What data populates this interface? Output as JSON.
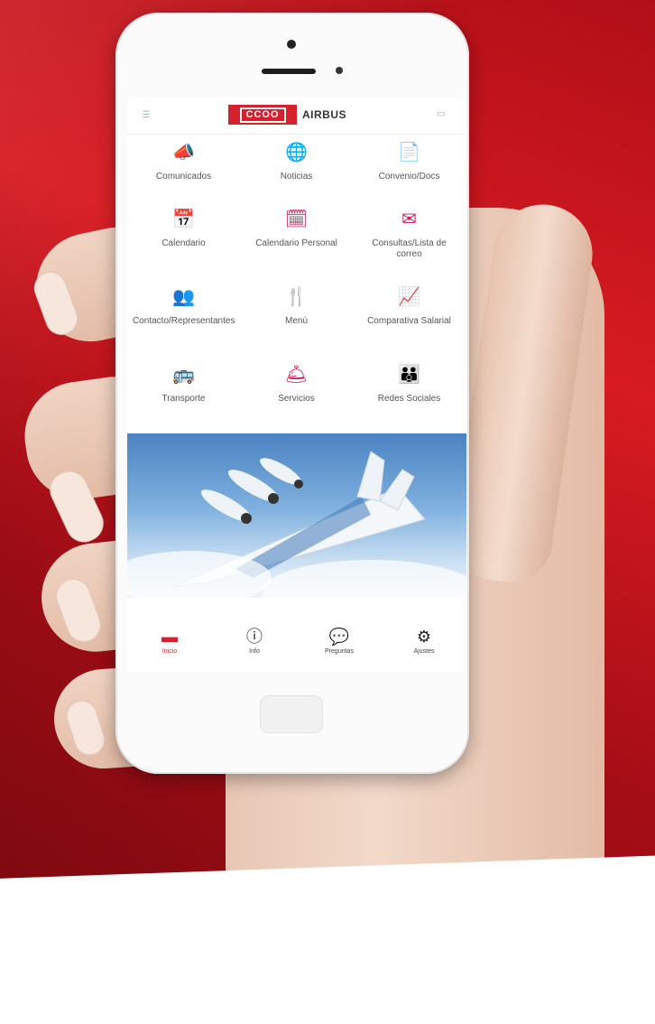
{
  "app": {
    "logo": "CCOO",
    "brand": "AIRBUS",
    "accent_color": "#d5212c"
  },
  "header": {
    "menu_icon": "menu-icon",
    "right_icon": "settings-icon"
  },
  "grid": [
    {
      "label": "Comunicados",
      "icon": "megaphone-icon",
      "glyph": "📣"
    },
    {
      "label": "Noticias",
      "icon": "globe-icon",
      "glyph": "🌐"
    },
    {
      "label": "Convenio/Docs",
      "icon": "document-icon",
      "glyph": "📄"
    },
    {
      "label": "Calendario",
      "icon": "calendar-icon",
      "glyph": "📅"
    },
    {
      "label": "Calendario Personal",
      "icon": "personal-calendar-icon",
      "glyph": "🗓"
    },
    {
      "label": "Consultas/Lista de correo",
      "icon": "mail-icon",
      "glyph": "✉"
    },
    {
      "label": "Contacto/Representantes",
      "icon": "people-icon",
      "glyph": "👥"
    },
    {
      "label": "Menú",
      "icon": "menu-food-icon",
      "glyph": "🍴"
    },
    {
      "label": "Comparativa Salarial",
      "icon": "chart-icon",
      "glyph": "📈"
    },
    {
      "label": "Transporte",
      "icon": "bus-icon",
      "glyph": "🚌"
    },
    {
      "label": "Servicios",
      "icon": "services-icon",
      "glyph": "🛎"
    },
    {
      "label": "Redes Sociales",
      "icon": "social-icon",
      "glyph": "👪"
    }
  ],
  "tabbar": [
    {
      "label": "Inicio",
      "icon": "home-icon",
      "glyph": "▬",
      "active": true
    },
    {
      "label": "Info",
      "icon": "info-icon",
      "glyph": "ⓘ",
      "active": false
    },
    {
      "label": "Preguntas",
      "icon": "chat-icon",
      "glyph": "💬",
      "active": false
    },
    {
      "label": "Ajustes",
      "icon": "sliders-icon",
      "glyph": "⚙",
      "active": false
    }
  ]
}
